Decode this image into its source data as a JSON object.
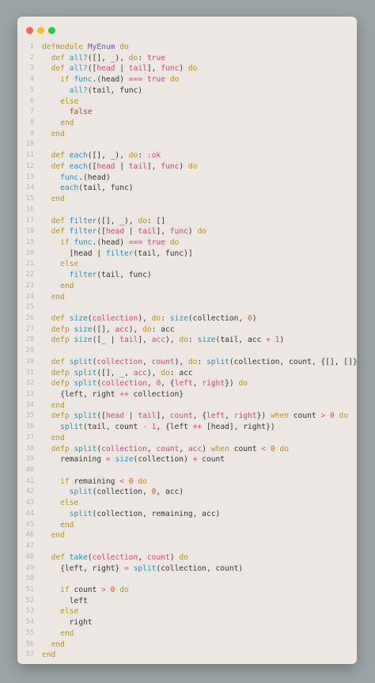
{
  "window": {
    "controls": [
      "close",
      "minimize",
      "zoom"
    ]
  },
  "colors": {
    "keyword": "#b5941a",
    "function": "#2b8fb6",
    "module": "#7b4fc9",
    "atom": "#d6437b",
    "operator": "#d6437b",
    "number": "#e0552b",
    "line_number": "#b9b3ad",
    "background": "#ece7e2"
  },
  "code": {
    "lines": [
      [
        [
          "k",
          "defmodule "
        ],
        [
          "m",
          "MyEnum"
        ],
        [
          "k",
          " do"
        ]
      ],
      [
        [
          "c",
          "  "
        ],
        [
          "k",
          "def "
        ],
        [
          "f",
          "all?"
        ],
        [
          "c",
          "([], _), "
        ],
        [
          "k",
          "do"
        ],
        [
          "c",
          ": "
        ],
        [
          "a",
          "true"
        ]
      ],
      [
        [
          "c",
          "  "
        ],
        [
          "k",
          "def "
        ],
        [
          "f",
          "all?"
        ],
        [
          "c",
          "(["
        ],
        [
          "a",
          "head"
        ],
        [
          "c",
          " | "
        ],
        [
          "a",
          "tail"
        ],
        [
          "c",
          "], "
        ],
        [
          "a",
          "func"
        ],
        [
          "c",
          ") "
        ],
        [
          "k",
          "do"
        ]
      ],
      [
        [
          "c",
          "    "
        ],
        [
          "k",
          "if "
        ],
        [
          "f",
          "func"
        ],
        [
          "c",
          ".(head) "
        ],
        [
          "a",
          "==="
        ],
        [
          "c",
          " "
        ],
        [
          "a",
          "true"
        ],
        [
          "k",
          " do"
        ]
      ],
      [
        [
          "c",
          "      "
        ],
        [
          "f",
          "all?"
        ],
        [
          "c",
          "(tail, func)"
        ]
      ],
      [
        [
          "c",
          "    "
        ],
        [
          "k",
          "else"
        ]
      ],
      [
        [
          "c",
          "      "
        ],
        [
          "r",
          "false"
        ]
      ],
      [
        [
          "c",
          "    "
        ],
        [
          "k",
          "end"
        ]
      ],
      [
        [
          "c",
          "  "
        ],
        [
          "k",
          "end"
        ]
      ],
      [],
      [
        [
          "c",
          "  "
        ],
        [
          "k",
          "def "
        ],
        [
          "f",
          "each"
        ],
        [
          "c",
          "([], _), "
        ],
        [
          "k",
          "do"
        ],
        [
          "c",
          ": "
        ],
        [
          "a",
          ":ok"
        ]
      ],
      [
        [
          "c",
          "  "
        ],
        [
          "k",
          "def "
        ],
        [
          "f",
          "each"
        ],
        [
          "c",
          "(["
        ],
        [
          "a",
          "head"
        ],
        [
          "c",
          " | "
        ],
        [
          "a",
          "tail"
        ],
        [
          "c",
          "], "
        ],
        [
          "a",
          "func"
        ],
        [
          "c",
          ") "
        ],
        [
          "k",
          "do"
        ]
      ],
      [
        [
          "c",
          "    "
        ],
        [
          "f",
          "func"
        ],
        [
          "c",
          ".(head)"
        ]
      ],
      [
        [
          "c",
          "    "
        ],
        [
          "f",
          "each"
        ],
        [
          "c",
          "(tail, func)"
        ]
      ],
      [
        [
          "c",
          "  "
        ],
        [
          "k",
          "end"
        ]
      ],
      [],
      [
        [
          "c",
          "  "
        ],
        [
          "k",
          "def "
        ],
        [
          "f",
          "filter"
        ],
        [
          "c",
          "([], _), "
        ],
        [
          "k",
          "do"
        ],
        [
          "c",
          ": []"
        ]
      ],
      [
        [
          "c",
          "  "
        ],
        [
          "k",
          "def "
        ],
        [
          "f",
          "filter"
        ],
        [
          "c",
          "(["
        ],
        [
          "a",
          "head"
        ],
        [
          "c",
          " | "
        ],
        [
          "a",
          "tail"
        ],
        [
          "c",
          "], "
        ],
        [
          "a",
          "func"
        ],
        [
          "c",
          ") "
        ],
        [
          "k",
          "do"
        ]
      ],
      [
        [
          "c",
          "    "
        ],
        [
          "k",
          "if "
        ],
        [
          "f",
          "func"
        ],
        [
          "c",
          ".(head) "
        ],
        [
          "a",
          "==="
        ],
        [
          "c",
          " "
        ],
        [
          "a",
          "true"
        ],
        [
          "k",
          " do"
        ]
      ],
      [
        [
          "c",
          "      [head | "
        ],
        [
          "f",
          "filter"
        ],
        [
          "c",
          "(tail, func)]"
        ]
      ],
      [
        [
          "c",
          "    "
        ],
        [
          "k",
          "else"
        ]
      ],
      [
        [
          "c",
          "      "
        ],
        [
          "f",
          "filter"
        ],
        [
          "c",
          "(tail, func)"
        ]
      ],
      [
        [
          "c",
          "    "
        ],
        [
          "k",
          "end"
        ]
      ],
      [
        [
          "c",
          "  "
        ],
        [
          "k",
          "end"
        ]
      ],
      [],
      [
        [
          "c",
          "  "
        ],
        [
          "k",
          "def "
        ],
        [
          "f",
          "size"
        ],
        [
          "c",
          "("
        ],
        [
          "a",
          "collection"
        ],
        [
          "c",
          "), "
        ],
        [
          "k",
          "do"
        ],
        [
          "c",
          ": "
        ],
        [
          "f",
          "size"
        ],
        [
          "c",
          "(collection, "
        ],
        [
          "n",
          "0"
        ],
        [
          "c",
          ")"
        ]
      ],
      [
        [
          "c",
          "  "
        ],
        [
          "k",
          "defp "
        ],
        [
          "f",
          "size"
        ],
        [
          "c",
          "([], "
        ],
        [
          "a",
          "acc"
        ],
        [
          "c",
          "), "
        ],
        [
          "k",
          "do"
        ],
        [
          "c",
          ": acc"
        ]
      ],
      [
        [
          "c",
          "  "
        ],
        [
          "k",
          "defp "
        ],
        [
          "f",
          "size"
        ],
        [
          "c",
          "([_ | "
        ],
        [
          "a",
          "tail"
        ],
        [
          "c",
          "], "
        ],
        [
          "a",
          "acc"
        ],
        [
          "c",
          "), "
        ],
        [
          "k",
          "do"
        ],
        [
          "c",
          ": "
        ],
        [
          "f",
          "size"
        ],
        [
          "c",
          "(tail, acc "
        ],
        [
          "a",
          "+"
        ],
        [
          "c",
          " "
        ],
        [
          "n",
          "1"
        ],
        [
          "c",
          ")"
        ]
      ],
      [],
      [
        [
          "c",
          "  "
        ],
        [
          "k",
          "def "
        ],
        [
          "f",
          "split"
        ],
        [
          "c",
          "("
        ],
        [
          "a",
          "collection"
        ],
        [
          "c",
          ", "
        ],
        [
          "a",
          "count"
        ],
        [
          "c",
          "), "
        ],
        [
          "k",
          "do"
        ],
        [
          "c",
          ": "
        ],
        [
          "f",
          "split"
        ],
        [
          "c",
          "(collection, count, {[], []})"
        ]
      ],
      [
        [
          "c",
          "  "
        ],
        [
          "k",
          "defp "
        ],
        [
          "f",
          "split"
        ],
        [
          "c",
          "([], _, "
        ],
        [
          "a",
          "acc"
        ],
        [
          "c",
          "), "
        ],
        [
          "k",
          "do"
        ],
        [
          "c",
          ": acc"
        ]
      ],
      [
        [
          "c",
          "  "
        ],
        [
          "k",
          "defp "
        ],
        [
          "f",
          "split"
        ],
        [
          "c",
          "("
        ],
        [
          "a",
          "collection"
        ],
        [
          "c",
          ", "
        ],
        [
          "n",
          "0"
        ],
        [
          "c",
          ", {"
        ],
        [
          "a",
          "left"
        ],
        [
          "c",
          ", "
        ],
        [
          "a",
          "right"
        ],
        [
          "c",
          "}) "
        ],
        [
          "k",
          "do"
        ]
      ],
      [
        [
          "c",
          "    {left, right "
        ],
        [
          "a",
          "++"
        ],
        [
          "c",
          " collection}"
        ]
      ],
      [
        [
          "c",
          "  "
        ],
        [
          "k",
          "end"
        ]
      ],
      [
        [
          "c",
          "  "
        ],
        [
          "k",
          "defp "
        ],
        [
          "f",
          "split"
        ],
        [
          "c",
          "(["
        ],
        [
          "a",
          "head"
        ],
        [
          "c",
          " | "
        ],
        [
          "a",
          "tail"
        ],
        [
          "c",
          "], "
        ],
        [
          "a",
          "count"
        ],
        [
          "c",
          ", {"
        ],
        [
          "a",
          "left"
        ],
        [
          "c",
          ", "
        ],
        [
          "a",
          "right"
        ],
        [
          "c",
          "}) "
        ],
        [
          "k",
          "when "
        ],
        [
          "c",
          "count "
        ],
        [
          "a",
          ">"
        ],
        [
          "c",
          " "
        ],
        [
          "n",
          "0"
        ],
        [
          "k",
          " do"
        ]
      ],
      [
        [
          "c",
          "    "
        ],
        [
          "f",
          "split"
        ],
        [
          "c",
          "(tail, count "
        ],
        [
          "a",
          "-"
        ],
        [
          "c",
          " "
        ],
        [
          "n",
          "1"
        ],
        [
          "c",
          ", {left "
        ],
        [
          "a",
          "++"
        ],
        [
          "c",
          " [head], right})"
        ]
      ],
      [
        [
          "c",
          "  "
        ],
        [
          "k",
          "end"
        ]
      ],
      [
        [
          "c",
          "  "
        ],
        [
          "k",
          "defp "
        ],
        [
          "f",
          "split"
        ],
        [
          "c",
          "("
        ],
        [
          "a",
          "collection"
        ],
        [
          "c",
          ", "
        ],
        [
          "a",
          "count"
        ],
        [
          "c",
          ", "
        ],
        [
          "a",
          "acc"
        ],
        [
          "c",
          ") "
        ],
        [
          "k",
          "when "
        ],
        [
          "c",
          "count "
        ],
        [
          "a",
          "<"
        ],
        [
          "c",
          " "
        ],
        [
          "n",
          "0"
        ],
        [
          "k",
          " do"
        ]
      ],
      [
        [
          "c",
          "    remaining "
        ],
        [
          "a",
          "="
        ],
        [
          "c",
          " "
        ],
        [
          "f",
          "size"
        ],
        [
          "c",
          "(collection) "
        ],
        [
          "a",
          "+"
        ],
        [
          "c",
          " count"
        ]
      ],
      [],
      [
        [
          "c",
          "    "
        ],
        [
          "k",
          "if "
        ],
        [
          "c",
          "remaining "
        ],
        [
          "a",
          "<"
        ],
        [
          "c",
          " "
        ],
        [
          "n",
          "0"
        ],
        [
          "k",
          " do"
        ]
      ],
      [
        [
          "c",
          "      "
        ],
        [
          "f",
          "split"
        ],
        [
          "c",
          "(collection, "
        ],
        [
          "n",
          "0"
        ],
        [
          "c",
          ", acc)"
        ]
      ],
      [
        [
          "c",
          "    "
        ],
        [
          "k",
          "else"
        ]
      ],
      [
        [
          "c",
          "      "
        ],
        [
          "f",
          "split"
        ],
        [
          "c",
          "(collection, remaining, acc)"
        ]
      ],
      [
        [
          "c",
          "    "
        ],
        [
          "k",
          "end"
        ]
      ],
      [
        [
          "c",
          "  "
        ],
        [
          "k",
          "end"
        ]
      ],
      [],
      [
        [
          "c",
          "  "
        ],
        [
          "k",
          "def "
        ],
        [
          "f",
          "take"
        ],
        [
          "c",
          "("
        ],
        [
          "a",
          "collection"
        ],
        [
          "c",
          ", "
        ],
        [
          "a",
          "count"
        ],
        [
          "c",
          ") "
        ],
        [
          "k",
          "do"
        ]
      ],
      [
        [
          "c",
          "    {left, right} "
        ],
        [
          "a",
          "="
        ],
        [
          "c",
          " "
        ],
        [
          "f",
          "split"
        ],
        [
          "c",
          "(collection, count)"
        ]
      ],
      [],
      [
        [
          "c",
          "    "
        ],
        [
          "k",
          "if "
        ],
        [
          "c",
          "count "
        ],
        [
          "a",
          ">"
        ],
        [
          "c",
          " "
        ],
        [
          "n",
          "0"
        ],
        [
          "k",
          " do"
        ]
      ],
      [
        [
          "c",
          "      left"
        ]
      ],
      [
        [
          "c",
          "    "
        ],
        [
          "k",
          "else"
        ]
      ],
      [
        [
          "c",
          "      right"
        ]
      ],
      [
        [
          "c",
          "    "
        ],
        [
          "k",
          "end"
        ]
      ],
      [
        [
          "c",
          "  "
        ],
        [
          "k",
          "end"
        ]
      ],
      [
        [
          "k",
          "end"
        ]
      ]
    ]
  }
}
